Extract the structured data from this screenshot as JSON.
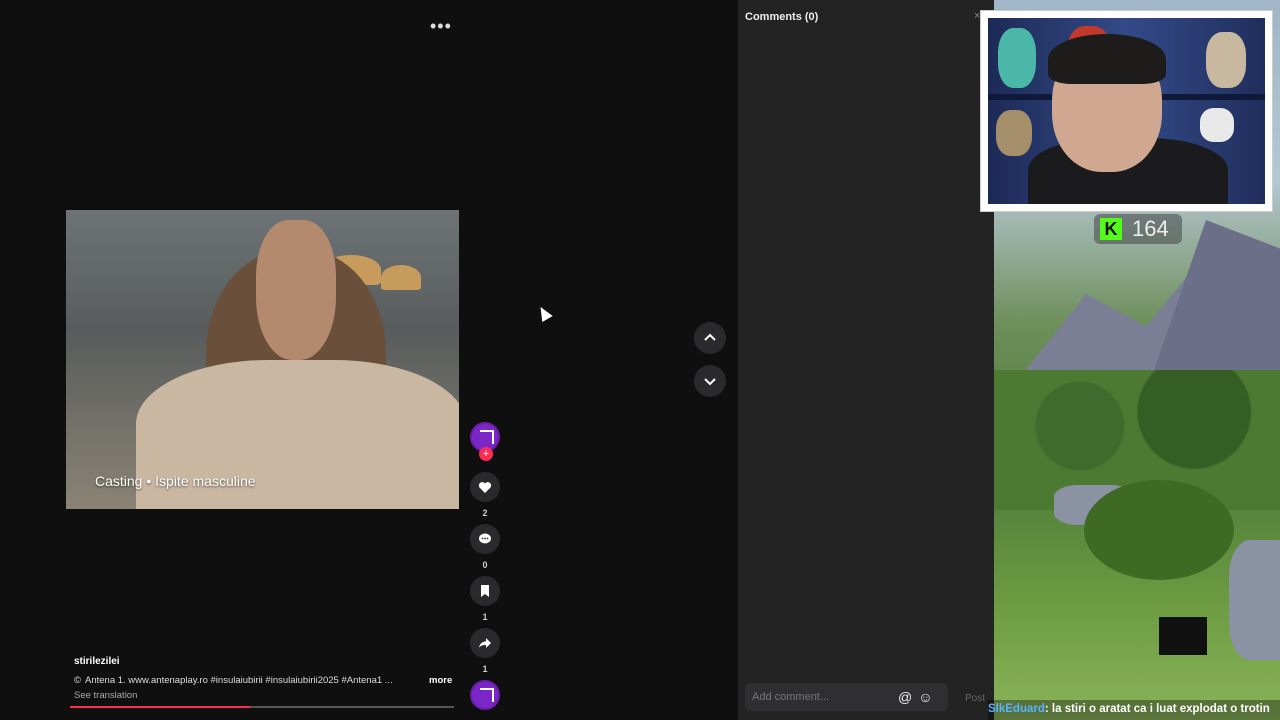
{
  "feed": {
    "more_icon": "ellipsis-icon",
    "video": {
      "caption": "Casting • Ispite masculine"
    },
    "author": "stirilezilei",
    "description": "Antena 1. www.antenaplay.ro  #insulaiubirii  #insulaiubirii2025  #Antena1  ...",
    "description_prefix": "©",
    "more_label": "more",
    "see_translation": "See translation",
    "progress": 0.47,
    "actions": {
      "likes": "2",
      "comments": "0",
      "saves": "1",
      "shares": "1"
    },
    "colors": {
      "accent": "#fe2c55",
      "avatar": "#7b26c6"
    }
  },
  "comments_panel": {
    "title": "Comments (0)",
    "placeholder": "Add comment...",
    "mention_icon": "at-icon",
    "emoji_icon": "emoji-icon",
    "post_label": "Post"
  },
  "stream_overlay": {
    "kick_logo": "K",
    "viewer_count": "164",
    "chat": {
      "user": "SlkEduard",
      "message": ": la stiri o aratat ca i luat explodat o trotin"
    },
    "colors": {
      "kick_green": "#53fc18",
      "chat_user": "#5ab1ff"
    }
  }
}
